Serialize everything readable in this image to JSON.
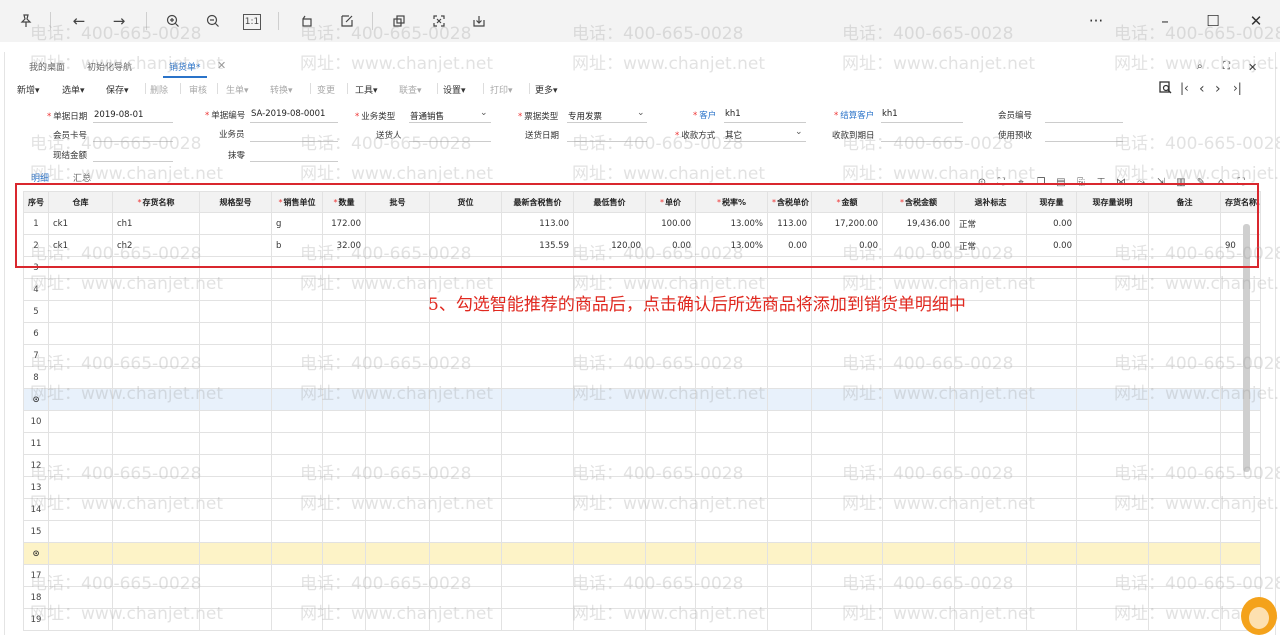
{
  "viewer": {
    "icons": [
      "pin-icon",
      "back-icon",
      "forward-icon",
      "zoom-in-icon",
      "zoom-out-icon",
      "actual-size-icon",
      "rotate-icon",
      "edit-icon",
      "crop-icon",
      "fullscreen-icon",
      "save-icon"
    ],
    "actual_size_label": "1:1"
  },
  "tabs": [
    "我的桌面",
    "初始化导航",
    "销货单*"
  ],
  "toolbar": {
    "items": [
      "新增▾",
      "选单▾",
      "保存▾",
      "删除",
      "审核",
      "生单▾",
      "转换▾",
      "变更",
      "工具▾",
      "联查▾",
      "设置▾",
      "打印▾",
      "更多▾"
    ]
  },
  "form": {
    "date_label": "单据日期",
    "date_value": "2019-08-01",
    "no_label": "单据编号",
    "no_value": "SA-2019-08-0001",
    "biz_type_label": "业务类型",
    "biz_type_value": "普通销售",
    "invoice_type_label": "票据类型",
    "invoice_type_value": "专用发票",
    "customer_label": "客户",
    "customer_value": "kh1",
    "settle_customer_label": "结算客户",
    "settle_customer_value": "kh1",
    "member_no_label": "会员编号",
    "member_card_label": "会员卡号",
    "salesman_label": "业务员",
    "deliverer_label": "送货人",
    "delivery_date_label": "送货日期",
    "pay_method_label": "收款方式",
    "pay_method_value": "其它",
    "due_date_label": "收款到期日",
    "use_prepay_label": "使用预收",
    "cash_amount_label": "现结金额",
    "wipe_label": "抹零"
  },
  "detail_tabs": [
    "明细",
    "汇总"
  ],
  "grid": {
    "headers": [
      "序号",
      "仓库",
      "存货名称",
      "规格型号",
      "销售单位",
      "数量",
      "批号",
      "货位",
      "最新含税售价",
      "最低售价",
      "单价",
      "税率%",
      "含税单价",
      "金额",
      "含税金额",
      "退补标志",
      "现存量",
      "现存量说明",
      "备注",
      "存货名称."
    ],
    "required_cols": [
      2,
      4,
      5,
      10,
      11,
      12,
      13,
      14
    ],
    "rows": [
      [
        "1",
        "ck1",
        "ch1",
        "",
        "g",
        "172.00",
        "",
        "",
        "113.00",
        "",
        "100.00",
        "13.00%",
        "113.00",
        "17,200.00",
        "19,436.00",
        "正常",
        "0.00",
        "",
        "",
        ""
      ],
      [
        "2",
        "ck1",
        "ch2",
        "",
        "b",
        "32.00",
        "",
        "",
        "135.59",
        "120.00",
        "0.00",
        "13.00%",
        "0.00",
        "0.00",
        "0.00",
        "正常",
        "0.00",
        "",
        "",
        "90"
      ],
      [
        "3"
      ],
      [
        "4"
      ],
      [
        "5"
      ],
      [
        "6"
      ],
      [
        "7"
      ],
      [
        "8"
      ],
      [
        "⊙"
      ],
      [
        "10"
      ],
      [
        "11"
      ],
      [
        "12"
      ],
      [
        "13"
      ],
      [
        "14"
      ],
      [
        "15"
      ],
      [
        "⊙"
      ],
      [
        "17"
      ],
      [
        "18"
      ],
      [
        "19"
      ]
    ]
  },
  "annotation": "5、勾选智能推荐的商品后，点击确认后所选商品将添加到销货单明细中",
  "watermark": {
    "phone": "电话：400-665-0028",
    "site": "网址：www.chanjet.net"
  }
}
